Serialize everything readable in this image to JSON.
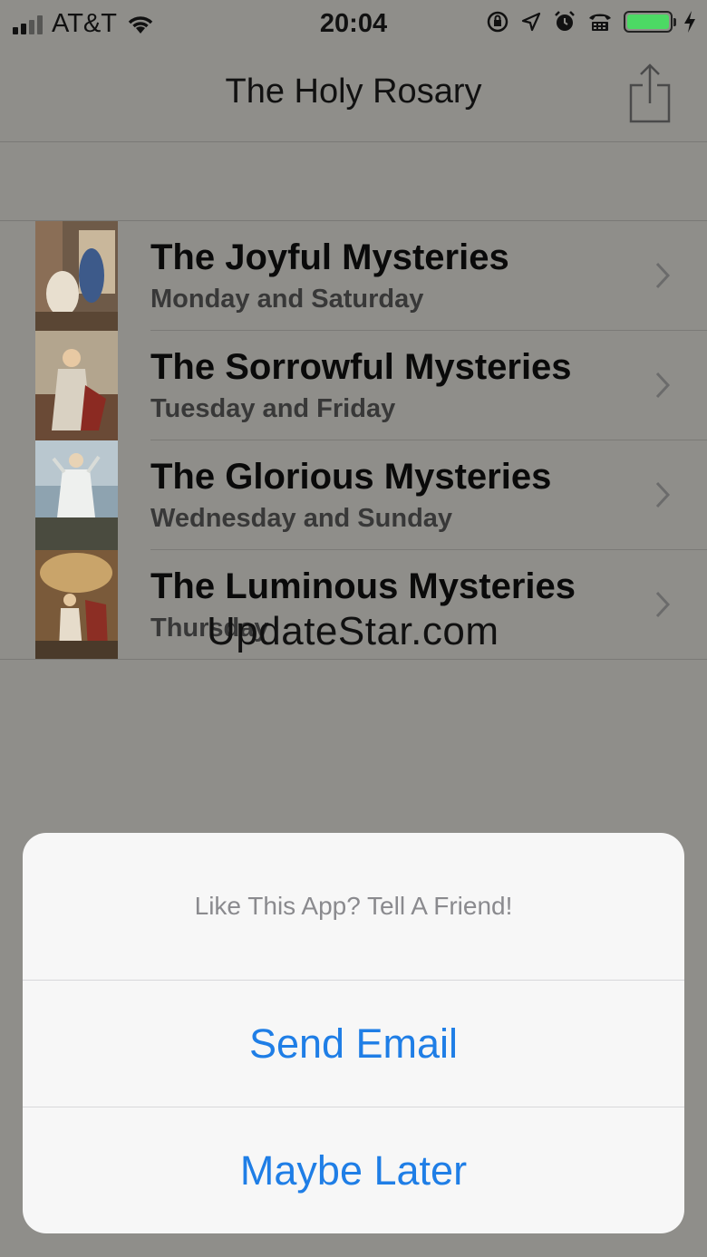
{
  "status": {
    "carrier": "AT&T",
    "time": "20:04",
    "battery_level": 1.0,
    "battery_color": "#4cd964",
    "icons": [
      "signal-icon",
      "wifi-icon",
      "orientation-lock-icon",
      "location-icon",
      "alarm-icon",
      "tty-icon",
      "battery-icon",
      "charging-icon"
    ]
  },
  "nav": {
    "title": "The Holy Rosary",
    "share_icon": "share-icon"
  },
  "mysteries": [
    {
      "title": "The Joyful Mysteries",
      "days": "Monday and Saturday"
    },
    {
      "title": "The Sorrowful Mysteries",
      "days": "Tuesday and Friday"
    },
    {
      "title": "The Glorious Mysteries",
      "days": "Wednesday and Sunday"
    },
    {
      "title": "The Luminous Mysteries",
      "days": "Thursday"
    }
  ],
  "watermark": "UpdateStar.com",
  "action_sheet": {
    "message": "Like This App? Tell A Friend!",
    "send_email": "Send Email",
    "maybe_later": "Maybe Later",
    "button_color": "#1f7ee6"
  }
}
